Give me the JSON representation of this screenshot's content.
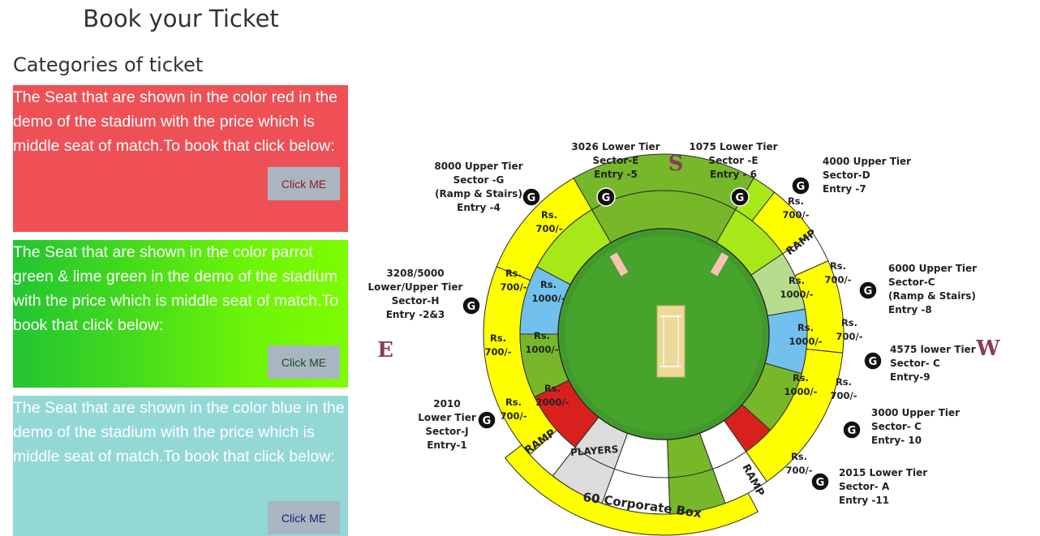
{
  "page": {
    "title": "Book your Ticket",
    "subtitle": "Categories of ticket"
  },
  "cards": [
    {
      "text": "The Seat that are shown in the color red in the demo of the stadium with the price which is middle seat of match.To book that click below:",
      "button": "Click ME",
      "color": "#ee5056"
    },
    {
      "text": "The Seat that are shown in the color parrot green & lime green in the demo of the stadium with the price which is middle seat of match.To book that click below:",
      "button": "Click ME",
      "color": "#7dfc00"
    },
    {
      "text": "The Seat that are shown in the color blue in the demo of the stadium with the price which is middle seat of match.To book that click below:",
      "button": "Click ME",
      "color": "#93d8d5"
    }
  ],
  "stadium": {
    "directions": {
      "north": "S",
      "east": "E",
      "west": "W"
    },
    "gate_letter": "G",
    "ramp": "RAMP",
    "players": "PLAYERS",
    "corporate": "60 Corporate Box",
    "prices": {
      "p700": [
        "Rs.",
        "700/-"
      ],
      "p1000": [
        "Rs.",
        "1000/-"
      ],
      "p2000": [
        "Rs.",
        "2000/-"
      ]
    },
    "entries": {
      "g": [
        "8000 Upper Tier",
        "Sector -G",
        "(Ramp & Stairs)",
        "Entry -4"
      ],
      "e5": [
        "3026 Lower Tier",
        "Sector-E",
        "Entry -5"
      ],
      "e6": [
        "1075 Lower Tier",
        "Sector -E",
        "Entry - 6"
      ],
      "d": [
        "4000 Upper Tier",
        "Sector-D",
        "Entry -7"
      ],
      "h": [
        "3208/5000",
        "Lower/Upper Tier",
        "Sector-H",
        "Entry -2&3"
      ],
      "c8": [
        "6000 Upper Tier",
        "Sector-C",
        "(Ramp & Stairs)",
        "Entry -8"
      ],
      "c9": [
        "4575 lower Tier",
        "Sector- C",
        "Entry-9"
      ],
      "j": [
        "2010",
        "Lower Tier",
        "Sector-J",
        "Entry-1"
      ],
      "c10": [
        "3000 Upper Tier",
        "Sector- C",
        "Entry- 10"
      ],
      "a": [
        "2015 Lower Tier",
        "Sector- A",
        "Entry -11"
      ]
    },
    "colors": {
      "yellow": "#ffff00",
      "field": "#46a32c",
      "dark_green": "#77b82a",
      "lime": "#a6e818",
      "blue": "#72c0ee",
      "red": "#d8211c",
      "pale_green": "#b7dc8e",
      "grey": "#dcdcdc",
      "pitch": "#ecd99a"
    }
  }
}
